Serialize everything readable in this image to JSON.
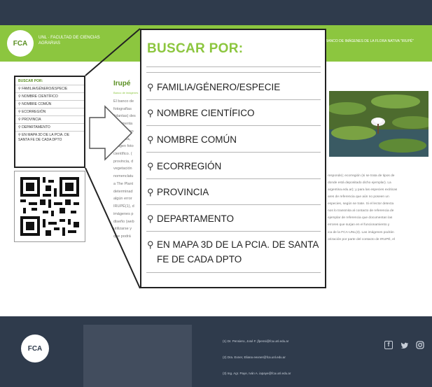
{
  "header": {
    "logo_text": "FCA",
    "brand_text": "UNL · FACULTAD DE CIENCIAS AGRARIAS",
    "right_text": "BANCO DE IMÁGENES DE LA FLORA NATIVA \"IRUPÉ\""
  },
  "left_panel": {
    "title": "BUSCAR POR:",
    "items": [
      "FAMILIA/GÉNERO/ESPECIE",
      "NOMBRE CIENTÍFICO",
      "NOMBRE COMÚN",
      "ECORREGIÓN",
      "PROVINCIA",
      "DEPARTAMENTO",
      "EN MAPA 3D DE LA PCIA. DE SANTA FE DE CADA DPTO"
    ]
  },
  "content": {
    "title": "Irupé",
    "subtitle": "Banco de imágenes",
    "lines": [
      "El banco de",
      "fotografías",
      "(plantas) des",
      "documenta",
      "además, no",
      "de planta,",
      "imagen foto",
      "científico. (",
      "provincia, d",
      "vegetación",
      "nomenclatu",
      "a The Plant",
      "determinad",
      "algún error",
      "IRUPÉ(1), d",
      "imágenes p",
      "diseño (web",
      "utilizarse y",
      "que podrá"
    ],
    "right_lines": [
      "responde); ecorregión (si se trata de tipos de",
      "donde está depositado dicho ejemplar). La",
      "argentina.edu.ar); y para las especies exóticas",
      "ares de referencia que aún no poseen un",
      "especies, según se trate. Si el lector detecta",
      "nos lo transmita al contacto de referencia de",
      "ejemplar de referencia que documentan las",
      "errores que surjan en el funcionamiento y",
      "ica de la FCA-UNL(3). Las imágenes podrán",
      "orización por parte del contacto de IRUPÉ, el"
    ]
  },
  "zoom": {
    "title": "BUSCAR POR:",
    "items": [
      "FAMILIA/GÉNERO/ESPECIE",
      "NOMBRE CIENTÍFICO",
      "NOMBRE COMÚN",
      "ECORREGIÓN",
      "PROVINCIA",
      "DEPARTAMENTO",
      "EN MAPA 3D DE LA PCIA. DE SANTA FE DE CADA DPTO"
    ],
    "icon": "location-pin-icon"
  },
  "footer": {
    "logo_text": "FCA",
    "contacts": [
      "(1) Dr. Pensiero, José F. jfpensi@fca.unl.edu.ar",
      "(2) Dra. Exner, Eliana eexner@fca.unl.edu.ar",
      "(3) Ing. Agr. Paye, Iván A. iapaye@fca.unl.edu.ar"
    ],
    "social": [
      "facebook-icon",
      "twitter-icon",
      "instagram-icon"
    ]
  },
  "colors": {
    "nav_dark": "#2f3b4c",
    "brand_green": "#8cc63f"
  }
}
